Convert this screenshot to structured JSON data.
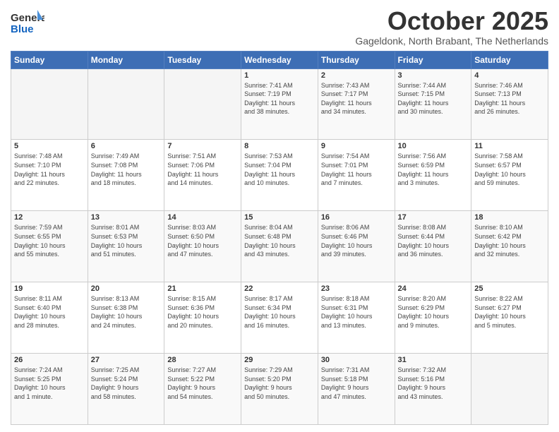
{
  "logo": {
    "line1": "General",
    "line2": "Blue"
  },
  "title": "October 2025",
  "location": "Gageldonk, North Brabant, The Netherlands",
  "weekdays": [
    "Sunday",
    "Monday",
    "Tuesday",
    "Wednesday",
    "Thursday",
    "Friday",
    "Saturday"
  ],
  "weeks": [
    [
      {
        "day": "",
        "info": ""
      },
      {
        "day": "",
        "info": ""
      },
      {
        "day": "",
        "info": ""
      },
      {
        "day": "1",
        "info": "Sunrise: 7:41 AM\nSunset: 7:19 PM\nDaylight: 11 hours\nand 38 minutes."
      },
      {
        "day": "2",
        "info": "Sunrise: 7:43 AM\nSunset: 7:17 PM\nDaylight: 11 hours\nand 34 minutes."
      },
      {
        "day": "3",
        "info": "Sunrise: 7:44 AM\nSunset: 7:15 PM\nDaylight: 11 hours\nand 30 minutes."
      },
      {
        "day": "4",
        "info": "Sunrise: 7:46 AM\nSunset: 7:13 PM\nDaylight: 11 hours\nand 26 minutes."
      }
    ],
    [
      {
        "day": "5",
        "info": "Sunrise: 7:48 AM\nSunset: 7:10 PM\nDaylight: 11 hours\nand 22 minutes."
      },
      {
        "day": "6",
        "info": "Sunrise: 7:49 AM\nSunset: 7:08 PM\nDaylight: 11 hours\nand 18 minutes."
      },
      {
        "day": "7",
        "info": "Sunrise: 7:51 AM\nSunset: 7:06 PM\nDaylight: 11 hours\nand 14 minutes."
      },
      {
        "day": "8",
        "info": "Sunrise: 7:53 AM\nSunset: 7:04 PM\nDaylight: 11 hours\nand 10 minutes."
      },
      {
        "day": "9",
        "info": "Sunrise: 7:54 AM\nSunset: 7:01 PM\nDaylight: 11 hours\nand 7 minutes."
      },
      {
        "day": "10",
        "info": "Sunrise: 7:56 AM\nSunset: 6:59 PM\nDaylight: 11 hours\nand 3 minutes."
      },
      {
        "day": "11",
        "info": "Sunrise: 7:58 AM\nSunset: 6:57 PM\nDaylight: 10 hours\nand 59 minutes."
      }
    ],
    [
      {
        "day": "12",
        "info": "Sunrise: 7:59 AM\nSunset: 6:55 PM\nDaylight: 10 hours\nand 55 minutes."
      },
      {
        "day": "13",
        "info": "Sunrise: 8:01 AM\nSunset: 6:53 PM\nDaylight: 10 hours\nand 51 minutes."
      },
      {
        "day": "14",
        "info": "Sunrise: 8:03 AM\nSunset: 6:50 PM\nDaylight: 10 hours\nand 47 minutes."
      },
      {
        "day": "15",
        "info": "Sunrise: 8:04 AM\nSunset: 6:48 PM\nDaylight: 10 hours\nand 43 minutes."
      },
      {
        "day": "16",
        "info": "Sunrise: 8:06 AM\nSunset: 6:46 PM\nDaylight: 10 hours\nand 39 minutes."
      },
      {
        "day": "17",
        "info": "Sunrise: 8:08 AM\nSunset: 6:44 PM\nDaylight: 10 hours\nand 36 minutes."
      },
      {
        "day": "18",
        "info": "Sunrise: 8:10 AM\nSunset: 6:42 PM\nDaylight: 10 hours\nand 32 minutes."
      }
    ],
    [
      {
        "day": "19",
        "info": "Sunrise: 8:11 AM\nSunset: 6:40 PM\nDaylight: 10 hours\nand 28 minutes."
      },
      {
        "day": "20",
        "info": "Sunrise: 8:13 AM\nSunset: 6:38 PM\nDaylight: 10 hours\nand 24 minutes."
      },
      {
        "day": "21",
        "info": "Sunrise: 8:15 AM\nSunset: 6:36 PM\nDaylight: 10 hours\nand 20 minutes."
      },
      {
        "day": "22",
        "info": "Sunrise: 8:17 AM\nSunset: 6:34 PM\nDaylight: 10 hours\nand 16 minutes."
      },
      {
        "day": "23",
        "info": "Sunrise: 8:18 AM\nSunset: 6:31 PM\nDaylight: 10 hours\nand 13 minutes."
      },
      {
        "day": "24",
        "info": "Sunrise: 8:20 AM\nSunset: 6:29 PM\nDaylight: 10 hours\nand 9 minutes."
      },
      {
        "day": "25",
        "info": "Sunrise: 8:22 AM\nSunset: 6:27 PM\nDaylight: 10 hours\nand 5 minutes."
      }
    ],
    [
      {
        "day": "26",
        "info": "Sunrise: 7:24 AM\nSunset: 5:25 PM\nDaylight: 10 hours\nand 1 minute."
      },
      {
        "day": "27",
        "info": "Sunrise: 7:25 AM\nSunset: 5:24 PM\nDaylight: 9 hours\nand 58 minutes."
      },
      {
        "day": "28",
        "info": "Sunrise: 7:27 AM\nSunset: 5:22 PM\nDaylight: 9 hours\nand 54 minutes."
      },
      {
        "day": "29",
        "info": "Sunrise: 7:29 AM\nSunset: 5:20 PM\nDaylight: 9 hours\nand 50 minutes."
      },
      {
        "day": "30",
        "info": "Sunrise: 7:31 AM\nSunset: 5:18 PM\nDaylight: 9 hours\nand 47 minutes."
      },
      {
        "day": "31",
        "info": "Sunrise: 7:32 AM\nSunset: 5:16 PM\nDaylight: 9 hours\nand 43 minutes."
      },
      {
        "day": "",
        "info": ""
      }
    ]
  ]
}
